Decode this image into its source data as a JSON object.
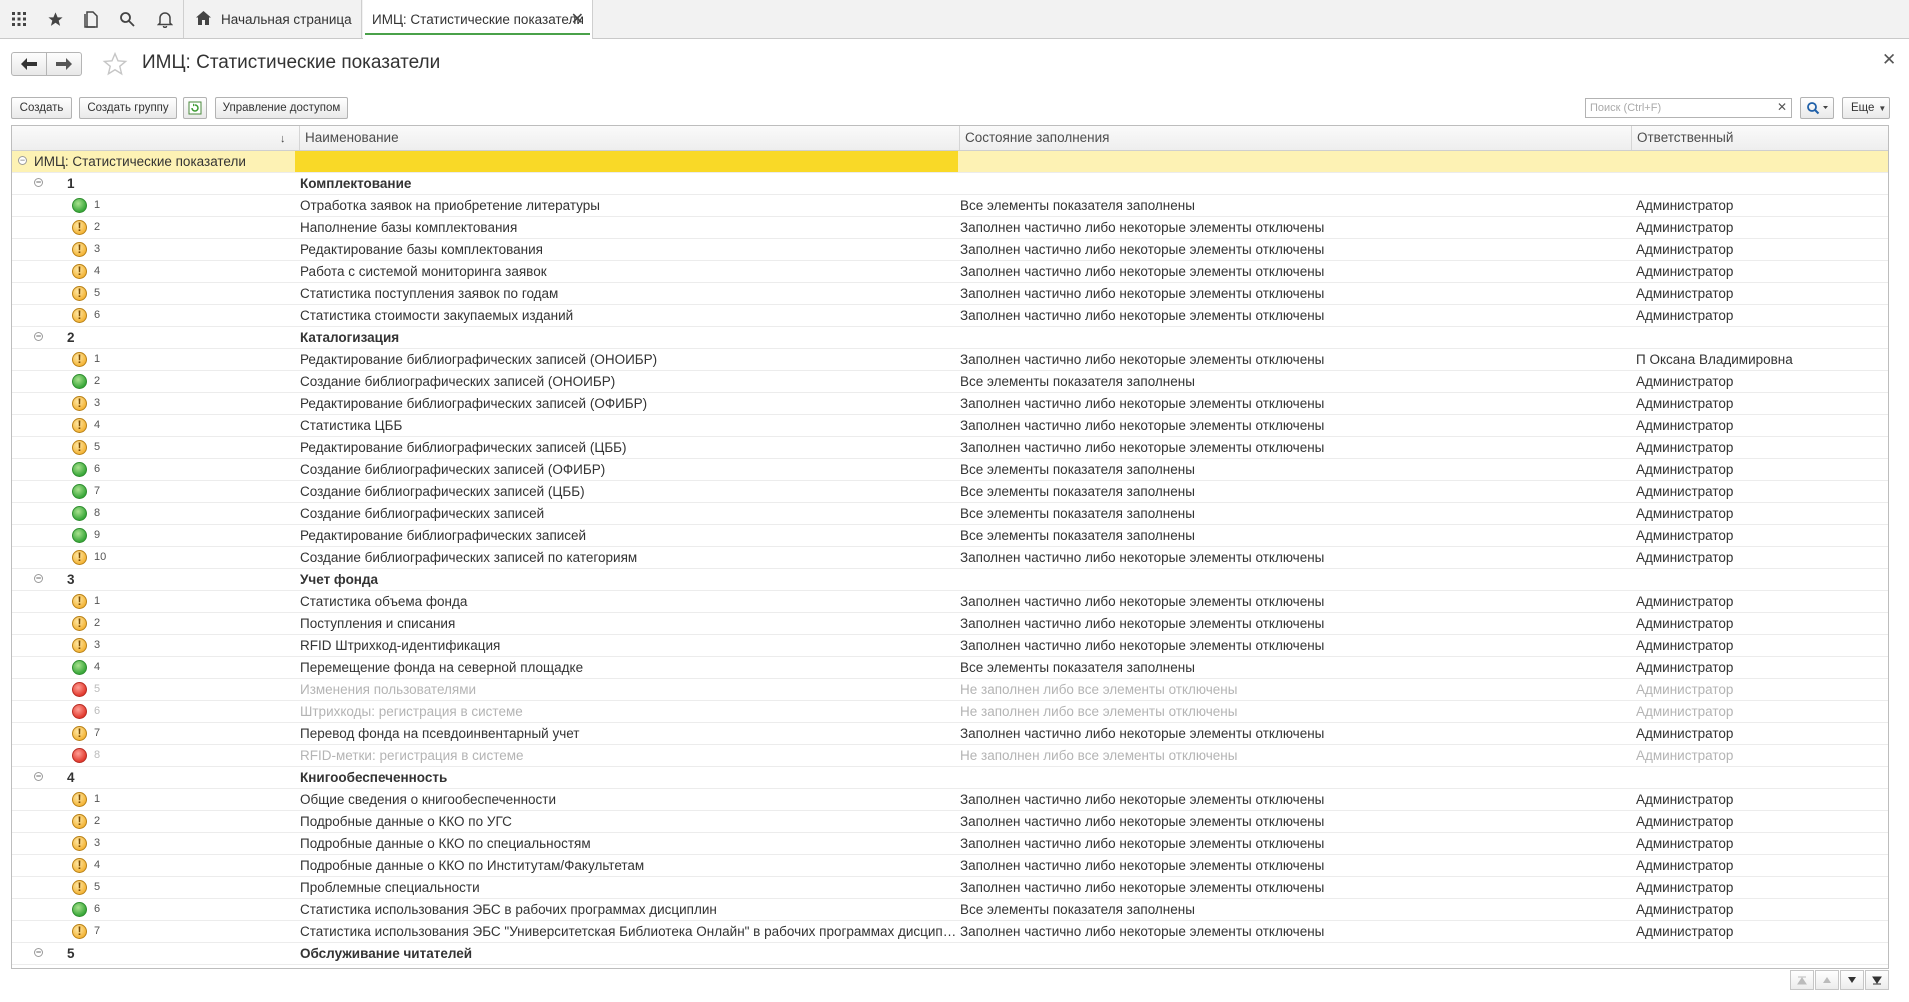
{
  "tabs": {
    "home_label": "Начальная страница",
    "active_label": "ИМЦ: Статистические показатели"
  },
  "form": {
    "title": "ИМЦ: Статистические показатели"
  },
  "toolbar": {
    "create": "Создать",
    "create_group": "Создать группу",
    "access": "Управление доступом",
    "search_placeholder": "Поиск (Ctrl+F)",
    "more": "Еще"
  },
  "columns": {
    "name": "Наименование",
    "state": "Состояние заполнения",
    "responsible": "Ответственный"
  },
  "root": {
    "label": "ИМЦ: Статистические показатели"
  },
  "groups": [
    {
      "num": "1",
      "name": "Комплектование",
      "items": [
        {
          "n": "1",
          "status": "green",
          "name": "Отработка заявок на приобретение литературы",
          "state": "Все элементы показателя заполнены",
          "resp": "Администратор"
        },
        {
          "n": "2",
          "status": "warn",
          "name": "Наполнение базы комплектования",
          "state": "Заполнен частично либо некоторые элементы отключены",
          "resp": "Администратор"
        },
        {
          "n": "3",
          "status": "warn",
          "name": "Редактирование базы комплектования",
          "state": "Заполнен частично либо некоторые элементы отключены",
          "resp": "Администратор"
        },
        {
          "n": "4",
          "status": "warn",
          "name": "Работа с системой мониторинга заявок",
          "state": "Заполнен частично либо некоторые элементы отключены",
          "resp": "Администратор"
        },
        {
          "n": "5",
          "status": "warn",
          "name": "Статистика поступления заявок по годам",
          "state": "Заполнен частично либо некоторые элементы отключены",
          "resp": "Администратор"
        },
        {
          "n": "6",
          "status": "warn",
          "name": "Статистика стоимости закупаемых изданий",
          "state": "Заполнен частично либо некоторые элементы отключены",
          "resp": "Администратор"
        }
      ]
    },
    {
      "num": "2",
      "name": "Каталогизация",
      "items": [
        {
          "n": "1",
          "status": "warn",
          "name": "Редактирование библиографических записей (ОНОИБР)",
          "state": "Заполнен частично либо некоторые элементы отключены",
          "resp": "П Оксана Владимировна"
        },
        {
          "n": "2",
          "status": "green",
          "name": "Создание библиографических записей (ОНОИБР)",
          "state": "Все элементы показателя заполнены",
          "resp": "Администратор"
        },
        {
          "n": "3",
          "status": "warn",
          "name": "Редактирование библиографических записей (ОФИБР)",
          "state": "Заполнен частично либо некоторые элементы отключены",
          "resp": "Администратор"
        },
        {
          "n": "4",
          "status": "warn",
          "name": "Статистика ЦББ",
          "state": "Заполнен частично либо некоторые элементы отключены",
          "resp": "Администратор"
        },
        {
          "n": "5",
          "status": "warn",
          "name": "Редактирование библиографических записей (ЦББ)",
          "state": "Заполнен частично либо некоторые элементы отключены",
          "resp": "Администратор"
        },
        {
          "n": "6",
          "status": "green",
          "name": "Создание библиографических записей (ОФИБР)",
          "state": "Все элементы показателя заполнены",
          "resp": "Администратор"
        },
        {
          "n": "7",
          "status": "green",
          "name": "Создание библиографических записей (ЦББ)",
          "state": "Все элементы показателя заполнены",
          "resp": "Администратор"
        },
        {
          "n": "8",
          "status": "green",
          "name": "Создание библиографических записей",
          "state": "Все элементы показателя заполнены",
          "resp": "Администратор"
        },
        {
          "n": "9",
          "status": "green",
          "name": "Редактирование библиографических записей",
          "state": "Все элементы показателя заполнены",
          "resp": "Администратор"
        },
        {
          "n": "10",
          "status": "warn",
          "name": "Создание библиографических записей по категориям",
          "state": "Заполнен частично либо некоторые элементы отключены",
          "resp": "Администратор"
        }
      ]
    },
    {
      "num": "3",
      "name": "Учет фонда",
      "items": [
        {
          "n": "1",
          "status": "warn",
          "name": "Статистика объема фонда",
          "state": "Заполнен частично либо некоторые элементы отключены",
          "resp": "Администратор"
        },
        {
          "n": "2",
          "status": "warn",
          "name": "Поступления и списания",
          "state": "Заполнен частично либо некоторые элементы отключены",
          "resp": "Администратор"
        },
        {
          "n": "3",
          "status": "warn",
          "name": "RFID Штрихкод-идентификация",
          "state": "Заполнен частично либо некоторые элементы отключены",
          "resp": "Администратор"
        },
        {
          "n": "4",
          "status": "green",
          "name": "Перемещение фонда на северной площадке",
          "state": "Все элементы показателя заполнены",
          "resp": "Администратор"
        },
        {
          "n": "5",
          "status": "red",
          "off": true,
          "name": "Изменения пользователями",
          "state": "Не заполнен либо все элементы отключены",
          "resp": "Администратор"
        },
        {
          "n": "6",
          "status": "red",
          "off": true,
          "name": "Штрихкоды: регистрация в системе",
          "state": "Не заполнен либо все элементы отключены",
          "resp": "Администратор"
        },
        {
          "n": "7",
          "status": "warn",
          "name": "Перевод фонда на псевдоинвентарный учет",
          "state": "Заполнен частично либо некоторые элементы отключены",
          "resp": "Администратор"
        },
        {
          "n": "8",
          "status": "red",
          "off": true,
          "name": "RFID-метки: регистрация в системе",
          "state": "Не заполнен либо все элементы отключены",
          "resp": "Администратор"
        }
      ]
    },
    {
      "num": "4",
      "name": "Книгообеспеченность",
      "items": [
        {
          "n": "1",
          "status": "warn",
          "name": "Общие сведения о книгообеспеченности",
          "state": "Заполнен частично либо некоторые элементы отключены",
          "resp": "Администратор"
        },
        {
          "n": "2",
          "status": "warn",
          "name": "Подробные данные о ККО по УГС",
          "state": "Заполнен частично либо некоторые элементы отключены",
          "resp": "Администратор"
        },
        {
          "n": "3",
          "status": "warn",
          "name": "Подробные данные о ККО по специальностям",
          "state": "Заполнен частично либо некоторые элементы отключены",
          "resp": "Администратор"
        },
        {
          "n": "4",
          "status": "warn",
          "name": "Подробные данные о ККО по Институтам/Факультетам",
          "state": "Заполнен частично либо некоторые элементы отключены",
          "resp": "Администратор"
        },
        {
          "n": "5",
          "status": "warn",
          "name": "Проблемные специальности",
          "state": "Заполнен частично либо некоторые элементы отключены",
          "resp": "Администратор"
        },
        {
          "n": "6",
          "status": "green",
          "name": "Статистика использования ЭБС в рабочих программах дисциплин",
          "state": "Все элементы показателя заполнены",
          "resp": "Администратор"
        },
        {
          "n": "7",
          "status": "warn",
          "name": "Статистика использования ЭБС \"Университетская Библиотека Онлайн\" в рабочих программах дисциплин",
          "state": "Заполнен частично либо некоторые элементы отключены",
          "resp": "Администратор"
        }
      ]
    },
    {
      "num": "5",
      "name": "Обслуживание читателей",
      "items": []
    }
  ]
}
